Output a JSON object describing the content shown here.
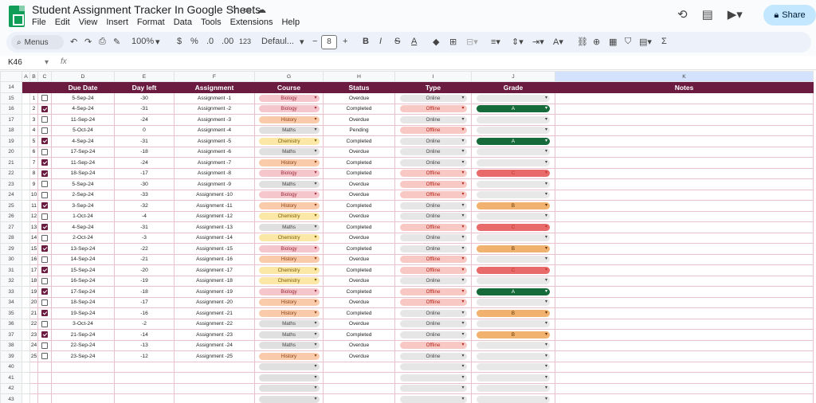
{
  "doc": {
    "title": "Student Assignment Tracker In Google Sheets",
    "share_label": "Share"
  },
  "menu": [
    "File",
    "Edit",
    "View",
    "Insert",
    "Format",
    "Data",
    "Tools",
    "Extensions",
    "Help"
  ],
  "toolbar": {
    "search": "Menus",
    "zoom": "100%",
    "currency": "$",
    "percent": "%",
    "dec_less": ".0",
    "dec_more": ".00",
    "number_format": "123",
    "font": "Defaul...",
    "font_size": "8"
  },
  "formula_bar": {
    "cell_ref": "K46",
    "fx": "fx"
  },
  "columns": [
    "A",
    "B",
    "C",
    "D",
    "E",
    "F",
    "G",
    "H",
    "I",
    "J",
    "K"
  ],
  "headers": [
    "Due Date",
    "Day left",
    "Assignment",
    "Course",
    "Status",
    "Type",
    "Grade",
    "Notes"
  ],
  "header_row_number": "14",
  "rows": [
    {
      "r": "15",
      "n": "1",
      "done": false,
      "date": "5-Sep-24",
      "left": "-30",
      "name": "Assignment -1",
      "course": "Biology",
      "status": "Overdue",
      "type": "Online",
      "grade": ""
    },
    {
      "r": "16",
      "n": "2",
      "done": true,
      "date": "4-Sep-24",
      "left": "-31",
      "name": "Assignment -2",
      "course": "Biology",
      "status": "Completed",
      "type": "Offline",
      "grade": "A"
    },
    {
      "r": "17",
      "n": "3",
      "done": false,
      "date": "11-Sep-24",
      "left": "-24",
      "name": "Assignment -3",
      "course": "History",
      "status": "Overdue",
      "type": "Online",
      "grade": ""
    },
    {
      "r": "18",
      "n": "4",
      "done": false,
      "date": "5-Oct-24",
      "left": "0",
      "name": "Assignment -4",
      "course": "Maths",
      "status": "Pending",
      "type": "Offline",
      "grade": ""
    },
    {
      "r": "19",
      "n": "5",
      "done": true,
      "date": "4-Sep-24",
      "left": "-31",
      "name": "Assignment -5",
      "course": "Chemistry",
      "status": "Completed",
      "type": "Online",
      "grade": "A"
    },
    {
      "r": "20",
      "n": "6",
      "done": false,
      "date": "17-Sep-24",
      "left": "-18",
      "name": "Assignment -6",
      "course": "Maths",
      "status": "Overdue",
      "type": "Online",
      "grade": ""
    },
    {
      "r": "21",
      "n": "7",
      "done": true,
      "date": "11-Sep-24",
      "left": "-24",
      "name": "Assignment -7",
      "course": "History",
      "status": "Completed",
      "type": "Online",
      "grade": ""
    },
    {
      "r": "22",
      "n": "8",
      "done": true,
      "date": "18-Sep-24",
      "left": "-17",
      "name": "Assignment -8",
      "course": "Biology",
      "status": "Completed",
      "type": "Offline",
      "grade": "C"
    },
    {
      "r": "23",
      "n": "9",
      "done": false,
      "date": "5-Sep-24",
      "left": "-30",
      "name": "Assignment -9",
      "course": "Maths",
      "status": "Overdue",
      "type": "Offline",
      "grade": ""
    },
    {
      "r": "24",
      "n": "10",
      "done": false,
      "date": "2-Sep-24",
      "left": "-33",
      "name": "Assignment -10",
      "course": "Biology",
      "status": "Overdue",
      "type": "Offline",
      "grade": ""
    },
    {
      "r": "25",
      "n": "11",
      "done": true,
      "date": "3-Sep-24",
      "left": "-32",
      "name": "Assignment -11",
      "course": "History",
      "status": "Completed",
      "type": "Online",
      "grade": "B"
    },
    {
      "r": "26",
      "n": "12",
      "done": false,
      "date": "1-Oct-24",
      "left": "-4",
      "name": "Assignment -12",
      "course": "Chemistry",
      "status": "Overdue",
      "type": "Online",
      "grade": ""
    },
    {
      "r": "27",
      "n": "13",
      "done": true,
      "date": "4-Sep-24",
      "left": "-31",
      "name": "Assignment -13",
      "course": "Maths",
      "status": "Completed",
      "type": "Offline",
      "grade": "C"
    },
    {
      "r": "28",
      "n": "14",
      "done": false,
      "date": "2-Oct-24",
      "left": "-3",
      "name": "Assignment -14",
      "course": "Chemistry",
      "status": "Overdue",
      "type": "Online",
      "grade": ""
    },
    {
      "r": "29",
      "n": "15",
      "done": true,
      "date": "13-Sep-24",
      "left": "-22",
      "name": "Assignment -15",
      "course": "Biology",
      "status": "Completed",
      "type": "Online",
      "grade": "B"
    },
    {
      "r": "30",
      "n": "16",
      "done": false,
      "date": "14-Sep-24",
      "left": "-21",
      "name": "Assignment -16",
      "course": "History",
      "status": "Overdue",
      "type": "Offline",
      "grade": ""
    },
    {
      "r": "31",
      "n": "17",
      "done": true,
      "date": "15-Sep-24",
      "left": "-20",
      "name": "Assignment -17",
      "course": "Chemistry",
      "status": "Completed",
      "type": "Offline",
      "grade": "C"
    },
    {
      "r": "32",
      "n": "18",
      "done": false,
      "date": "16-Sep-24",
      "left": "-19",
      "name": "Assignment -18",
      "course": "Chemistry",
      "status": "Overdue",
      "type": "Online",
      "grade": ""
    },
    {
      "r": "33",
      "n": "19",
      "done": true,
      "date": "17-Sep-24",
      "left": "-18",
      "name": "Assignment -19",
      "course": "Biology",
      "status": "Completed",
      "type": "Offline",
      "grade": "A"
    },
    {
      "r": "34",
      "n": "20",
      "done": false,
      "date": "18-Sep-24",
      "left": "-17",
      "name": "Assignment -20",
      "course": "History",
      "status": "Overdue",
      "type": "Offline",
      "grade": ""
    },
    {
      "r": "35",
      "n": "21",
      "done": true,
      "date": "19-Sep-24",
      "left": "-16",
      "name": "Assignment -21",
      "course": "History",
      "status": "Completed",
      "type": "Online",
      "grade": "B"
    },
    {
      "r": "36",
      "n": "22",
      "done": false,
      "date": "3-Oct-24",
      "left": "-2",
      "name": "Assignment -22",
      "course": "Maths",
      "status": "Overdue",
      "type": "Online",
      "grade": ""
    },
    {
      "r": "37",
      "n": "23",
      "done": true,
      "date": "21-Sep-24",
      "left": "-14",
      "name": "Assignment -23",
      "course": "Maths",
      "status": "Completed",
      "type": "Online",
      "grade": "B"
    },
    {
      "r": "38",
      "n": "24",
      "done": false,
      "date": "22-Sep-24",
      "left": "-13",
      "name": "Assignment -24",
      "course": "Maths",
      "status": "Overdue",
      "type": "Offline",
      "grade": ""
    },
    {
      "r": "39",
      "n": "25",
      "done": false,
      "date": "23-Sep-24",
      "left": "-12",
      "name": "Assignment -25",
      "course": "History",
      "status": "Overdue",
      "type": "Online",
      "grade": ""
    }
  ],
  "empty_rows": [
    "40",
    "41",
    "42",
    "43"
  ],
  "colors": {
    "header_bg": "#6b1b3f",
    "checkbox_on": "#6b1b3f",
    "grade_a": "#176b3a",
    "grade_b": "#f1b26f",
    "grade_c": "#e96a6a",
    "share_bg": "#c2e7ff"
  }
}
